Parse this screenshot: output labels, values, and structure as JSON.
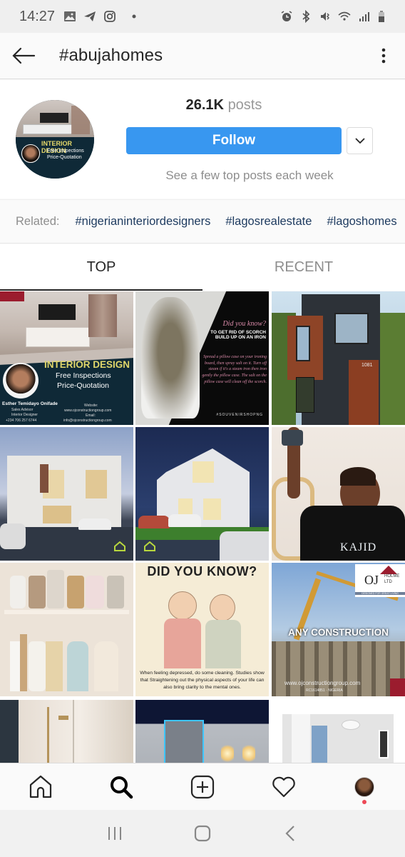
{
  "status_bar": {
    "time": "14:27",
    "left_icons": [
      "gallery-icon",
      "telegram-icon",
      "instagram-icon",
      "dot-icon"
    ],
    "right_icons": [
      "alarm-icon",
      "bluetooth-icon",
      "vibrate-icon",
      "wifi-icon",
      "signal-icon",
      "battery-icon"
    ]
  },
  "header": {
    "title": "#abujahomes",
    "back_icon": "arrow-left-icon",
    "more_icon": "more-vertical-icon"
  },
  "profile": {
    "posts_count": "26.1K",
    "posts_label": "posts",
    "follow_label": "Follow",
    "dropdown_icon": "chevron-down-icon",
    "subtext": "See a few top posts each week",
    "avatar": {
      "heading": "INTERIOR DESIGN",
      "line1": "Free Inspections",
      "line2": "Price-Quotation"
    }
  },
  "related": {
    "label": "Related:",
    "tags": [
      "#nigerianinteriordesigners",
      "#lagosrealestate",
      "#lagoshomes"
    ]
  },
  "tabs": [
    {
      "label": "TOP",
      "active": true
    },
    {
      "label": "RECENT",
      "active": false
    }
  ],
  "grid": {
    "tiles": [
      {
        "kind": "interior-design-ad",
        "heading": "INTERIOR DESIGN",
        "line1": "Free Inspections",
        "line2": "Price-Quotation",
        "name": "Esther Temidayo Onifade",
        "role1": "Sales Advisor",
        "role2": "Interior Designer",
        "phone": "+234 706 257 6744",
        "website_label": "Website:",
        "website": "www.ojconstructiongroup.com",
        "email_label": "Email:",
        "email": "info@ojconstructiongroup.com"
      },
      {
        "kind": "iron-tip",
        "heading": "Did you know?",
        "subheading": "TO GET RID OF SCORCH BUILD UP ON AN IRON",
        "body": "Spread a pillow case on your ironing board, then spray salt on it. Turn off steam if it's a steam iron then iron gently the pillow case. The salt on the pillow case will clean off the scorch.",
        "hashtag": "#SOUVENIRSHOPNG"
      },
      {
        "kind": "modern-house",
        "house_number": "1081"
      },
      {
        "kind": "render-villa-1"
      },
      {
        "kind": "render-villa-2"
      },
      {
        "kind": "woman-drill",
        "shirt_text": "KAJID"
      },
      {
        "kind": "handbags"
      },
      {
        "kind": "did-you-know-cleaning",
        "heading": "DID YOU KNOW?",
        "body": "When feeling depressed, do some cleaning. Studies show that Straightening out the physical aspects of your life can also bring clarity to the mental ones."
      },
      {
        "kind": "construction-ad",
        "logo_main": "OJ",
        "logo_side1": "HOLME",
        "logo_side2": "LTD",
        "tagline": "DESIGNED FOR GREAT LIVING",
        "heading": "ANY CONSTRUCTION",
        "website": "www.ojconstructiongroup.com",
        "footer": "RC1614851 · NIGERIA"
      },
      {
        "kind": "shower"
      },
      {
        "kind": "lit-wall"
      },
      {
        "kind": "white-room"
      }
    ]
  },
  "bottom_nav": {
    "items": [
      "home-icon",
      "search-icon",
      "add-post-icon",
      "heart-icon",
      "profile-avatar"
    ]
  },
  "system_nav": {
    "items": [
      "recent-apps-icon",
      "home-button-icon",
      "back-chevron-icon"
    ]
  },
  "colors": {
    "accent": "#3897f0",
    "related_tag": "#1d3a5f",
    "notification": "#ed4956"
  }
}
